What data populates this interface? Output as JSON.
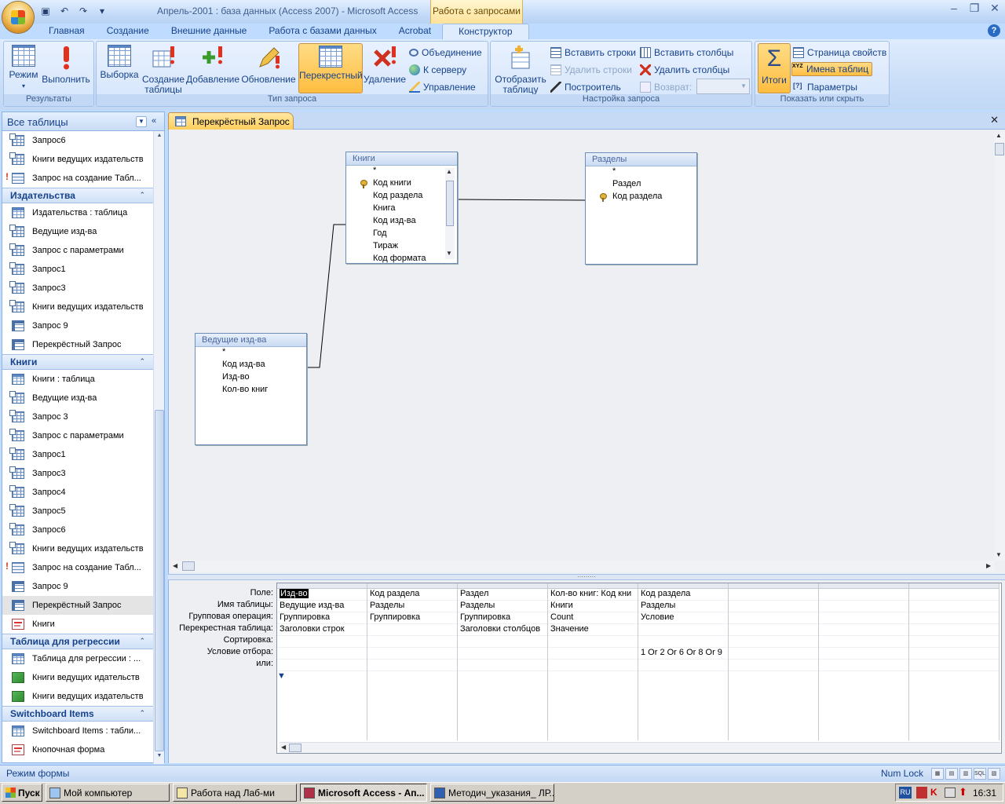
{
  "window": {
    "title": "Апрель-2001 : база данных (Access 2007) - Microsoft Access",
    "context_tab_title": "Работа с запросами"
  },
  "ribbon": {
    "tabs": [
      "Главная",
      "Создание",
      "Внешние данные",
      "Работа с базами данных",
      "Acrobat",
      "Конструктор"
    ],
    "active_tab": "Конструктор",
    "groups": {
      "results": {
        "label": "Результаты",
        "mode": "Режим",
        "run": "Выполнить"
      },
      "query_type": {
        "label": "Тип запроса",
        "select": "Выборка",
        "make_table_1": "Создание",
        "make_table_2": "таблицы",
        "append": "Добавление",
        "update": "Обновление",
        "crosstab": "Перекрестный",
        "delete": "Удаление",
        "union": "Объединение",
        "passthrough": "К серверу",
        "data_definition": "Управление"
      },
      "query_setup": {
        "label": "Настройка запроса",
        "show_table_1": "Отобразить",
        "show_table_2": "таблицу",
        "insert_rows": "Вставить строки",
        "delete_rows": "Удалить строки",
        "builder": "Построитель",
        "insert_columns": "Вставить столбцы",
        "delete_columns": "Удалить столбцы",
        "return_label": "Возврат:",
        "return_value": ""
      },
      "show_hide": {
        "label": "Показать или скрыть",
        "totals": "Итоги",
        "property_sheet": "Страница свойств",
        "table_names": "Имена таблиц",
        "parameters": "Параметры"
      }
    }
  },
  "nav": {
    "header": "Все таблицы",
    "top_items": [
      {
        "label": "Запрос6",
        "icon": "query"
      },
      {
        "label": "Книги ведущих издательств",
        "icon": "query"
      },
      {
        "label": "Запрос на создание Табл...",
        "icon": "maketable"
      }
    ],
    "groups": [
      {
        "label": "Издательства",
        "items": [
          {
            "label": "Издательства : таблица",
            "icon": "table"
          },
          {
            "label": "Ведущие изд-ва",
            "icon": "query"
          },
          {
            "label": "Запрос с параметрами",
            "icon": "query"
          },
          {
            "label": "Запрос1",
            "icon": "query"
          },
          {
            "label": "Запрос3",
            "icon": "query"
          },
          {
            "label": "Книги ведущих издательств",
            "icon": "query"
          },
          {
            "label": "Запрос 9",
            "icon": "crosstab"
          },
          {
            "label": "Перекрёстный Запрос",
            "icon": "crosstab"
          }
        ]
      },
      {
        "label": "Книги",
        "items": [
          {
            "label": "Книги : таблица",
            "icon": "table"
          },
          {
            "label": "Ведущие изд-ва",
            "icon": "query"
          },
          {
            "label": "Запрос 3",
            "icon": "query"
          },
          {
            "label": "Запрос с параметрами",
            "icon": "query"
          },
          {
            "label": "Запрос1",
            "icon": "query"
          },
          {
            "label": "Запрос3",
            "icon": "query"
          },
          {
            "label": "Запрос4",
            "icon": "query"
          },
          {
            "label": "Запрос5",
            "icon": "query"
          },
          {
            "label": "Запрос6",
            "icon": "query"
          },
          {
            "label": "Книги ведущих издательств",
            "icon": "query"
          },
          {
            "label": "Запрос на создание Табл...",
            "icon": "maketable"
          },
          {
            "label": "Запрос 9",
            "icon": "crosstab"
          },
          {
            "label": "Перекрёстный Запрос",
            "icon": "crosstab",
            "selected": true
          },
          {
            "label": "Книги",
            "icon": "form"
          }
        ]
      },
      {
        "label": "Таблица для регрессии",
        "items": [
          {
            "label": "Таблица для регрессии : ...",
            "icon": "table"
          },
          {
            "label": "Книги ведущих идательств",
            "icon": "report"
          },
          {
            "label": "Книги ведущих издательств",
            "icon": "report"
          }
        ]
      },
      {
        "label": "Switchboard Items",
        "items": [
          {
            "label": "Switchboard Items : табли...",
            "icon": "table"
          },
          {
            "label": "Кнопочная форма",
            "icon": "form"
          }
        ]
      }
    ]
  },
  "document": {
    "tab_title": "Перекрёстный Запрос",
    "tables": {
      "books": {
        "title": "Книги",
        "fields": [
          {
            "name": "*",
            "key": false
          },
          {
            "name": "Код книги",
            "key": true
          },
          {
            "name": "Код раздела",
            "key": false
          },
          {
            "name": "Книга",
            "key": false
          },
          {
            "name": "Код изд-ва",
            "key": false
          },
          {
            "name": "Год",
            "key": false
          },
          {
            "name": "Тираж",
            "key": false
          },
          {
            "name": "Код формата",
            "key": false
          }
        ]
      },
      "sections": {
        "title": "Разделы",
        "fields": [
          {
            "name": "*",
            "key": false
          },
          {
            "name": "Раздел",
            "key": false
          },
          {
            "name": "Код раздела",
            "key": true
          }
        ]
      },
      "publishers": {
        "title": "Ведущие изд-ва",
        "fields": [
          {
            "name": "*",
            "key": false
          },
          {
            "name": "Код изд-ва",
            "key": false
          },
          {
            "name": "Изд-во",
            "key": false
          },
          {
            "name": "Кол-во книг",
            "key": false
          }
        ]
      }
    },
    "grid": {
      "row_labels": [
        "Поле:",
        "Имя таблицы:",
        "Групповая операция:",
        "Перекрестная таблица:",
        "Сортировка:",
        "Условие отбора:",
        "или:"
      ],
      "columns": [
        [
          "Изд-во",
          "Ведущие изд-ва",
          "Группировка",
          "Заголовки строк",
          "",
          "",
          ""
        ],
        [
          "Код раздела",
          "Разделы",
          "Группировка",
          "",
          "",
          "",
          ""
        ],
        [
          "Раздел",
          "Разделы",
          "Группировка",
          "Заголовки столбцов",
          "",
          "",
          ""
        ],
        [
          "Кол-во книг: Код кни",
          "Книги",
          "Count",
          "Значение",
          "",
          "",
          ""
        ],
        [
          "Код раздела",
          "Разделы",
          "Условие",
          "",
          "",
          "1 Or 2 Or 6 Or 8 Or 9",
          ""
        ],
        [
          "",
          "",
          "",
          "",
          "",
          "",
          ""
        ],
        [
          "",
          "",
          "",
          "",
          "",
          "",
          ""
        ],
        [
          "",
          "",
          "",
          "",
          "",
          "",
          ""
        ]
      ]
    }
  },
  "status": {
    "left": "Режим формы",
    "right": "Num Lock"
  },
  "taskbar": {
    "start": "Пуск",
    "tasks": [
      "Мой компьютер",
      "Работа над Лаб-ми",
      "Microsoft Access - Ап...",
      "Методич_указания_ ЛР..."
    ],
    "lang": "RU",
    "clock": "16:31"
  },
  "colors": {
    "ribbon_bg": "#c7dcf7",
    "selected_button": "#ffbd40",
    "nav_group_text": "#15428b"
  }
}
